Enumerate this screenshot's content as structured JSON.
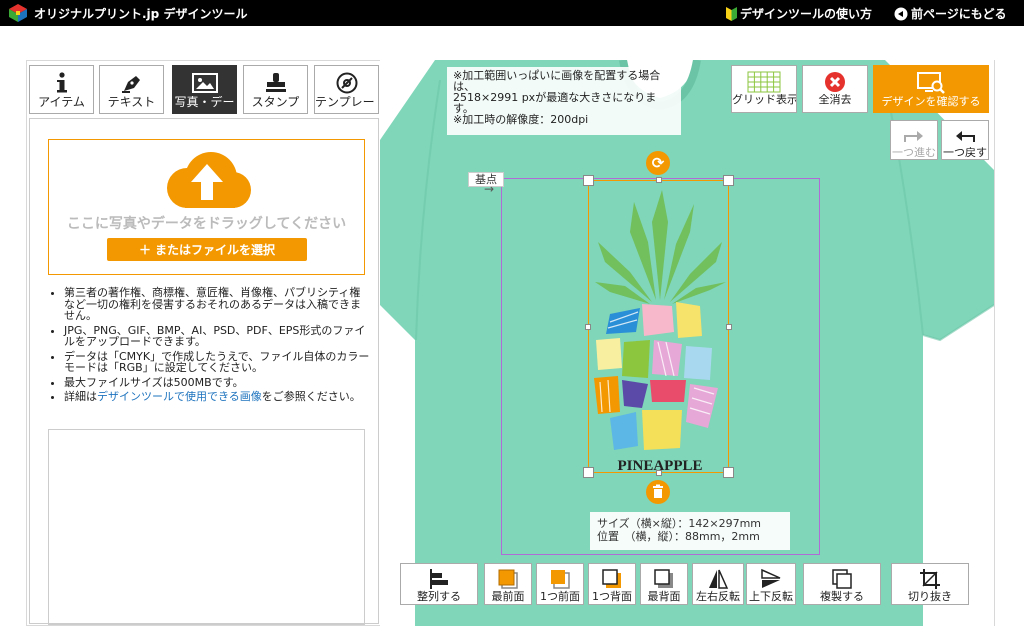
{
  "header": {
    "brand": "オリジナルプリント.jp デザインツール",
    "help_link": "デザインツールの使い方",
    "back_link": "前ページにもどる"
  },
  "tabs": [
    {
      "label": "アイテム",
      "icon": "info-icon"
    },
    {
      "label": "テキスト",
      "icon": "pen-icon"
    },
    {
      "label": "写真・デー",
      "icon": "image-icon",
      "active": true
    },
    {
      "label": "スタンプ",
      "icon": "stamp-icon"
    },
    {
      "label": "テンプレート",
      "icon": "template-icon"
    }
  ],
  "upload": {
    "drop_text": "ここに写真やデータをドラッグしてください",
    "file_button": "またはファイルを選択",
    "notes": [
      "第三者の著作権、商標権、意匠権、肖像権、パブリシティ権など一切の権利を侵害するおそれのあるデータは入稿できません。",
      "JPG、PNG、GIF、BMP、AI、PSD、PDF、EPS形式のファイルをアップロードできます。",
      "データは「CMYK」で作成したうえで、ファイル自体のカラーモードは「RGB」に設定してください。",
      "最大ファイルサイズは500MBです。"
    ],
    "note_link_prefix": "詳細は",
    "note_link": "デザインツールで使用できる画像",
    "note_link_suffix": "をご参照ください。"
  },
  "canvas": {
    "tip_lines": [
      "※加工範囲いっぱいに画像を配置する場合は、",
      "2518×2991 pxが最適な大きさになります。",
      "※加工時の解像度：200dpi"
    ],
    "anchor_label": "基点",
    "anchor_arrow": "→",
    "design_text": "PINEAPPLE",
    "size_label": "サイズ（横×縦）：142×297mm",
    "position_label": "位置　（横，縦）：88mm，2mm",
    "shirt_color": "#7fd6b8"
  },
  "toolbar": {
    "grid": "グリッド表示",
    "clear": "全消去",
    "confirm": "デザインを確認する",
    "redo": "一つ進む",
    "undo": "一つ戻す"
  },
  "bottom_tools": [
    {
      "label": "整列する",
      "icon": "align-icon"
    },
    {
      "label": "最前面",
      "icon": "bring-front-icon"
    },
    {
      "label": "1つ前面",
      "icon": "bring-forward-icon"
    },
    {
      "label": "1つ背面",
      "icon": "send-backward-icon"
    },
    {
      "label": "最背面",
      "icon": "send-back-icon"
    },
    {
      "label": "左右反転",
      "icon": "flip-horizontal-icon"
    },
    {
      "label": "上下反転",
      "icon": "flip-vertical-icon"
    },
    {
      "label": "複製する",
      "icon": "duplicate-icon"
    },
    {
      "label": "切り抜き",
      "icon": "crop-icon"
    }
  ],
  "colors": {
    "accent": "#f39800",
    "print_area": "#b06bd6"
  }
}
